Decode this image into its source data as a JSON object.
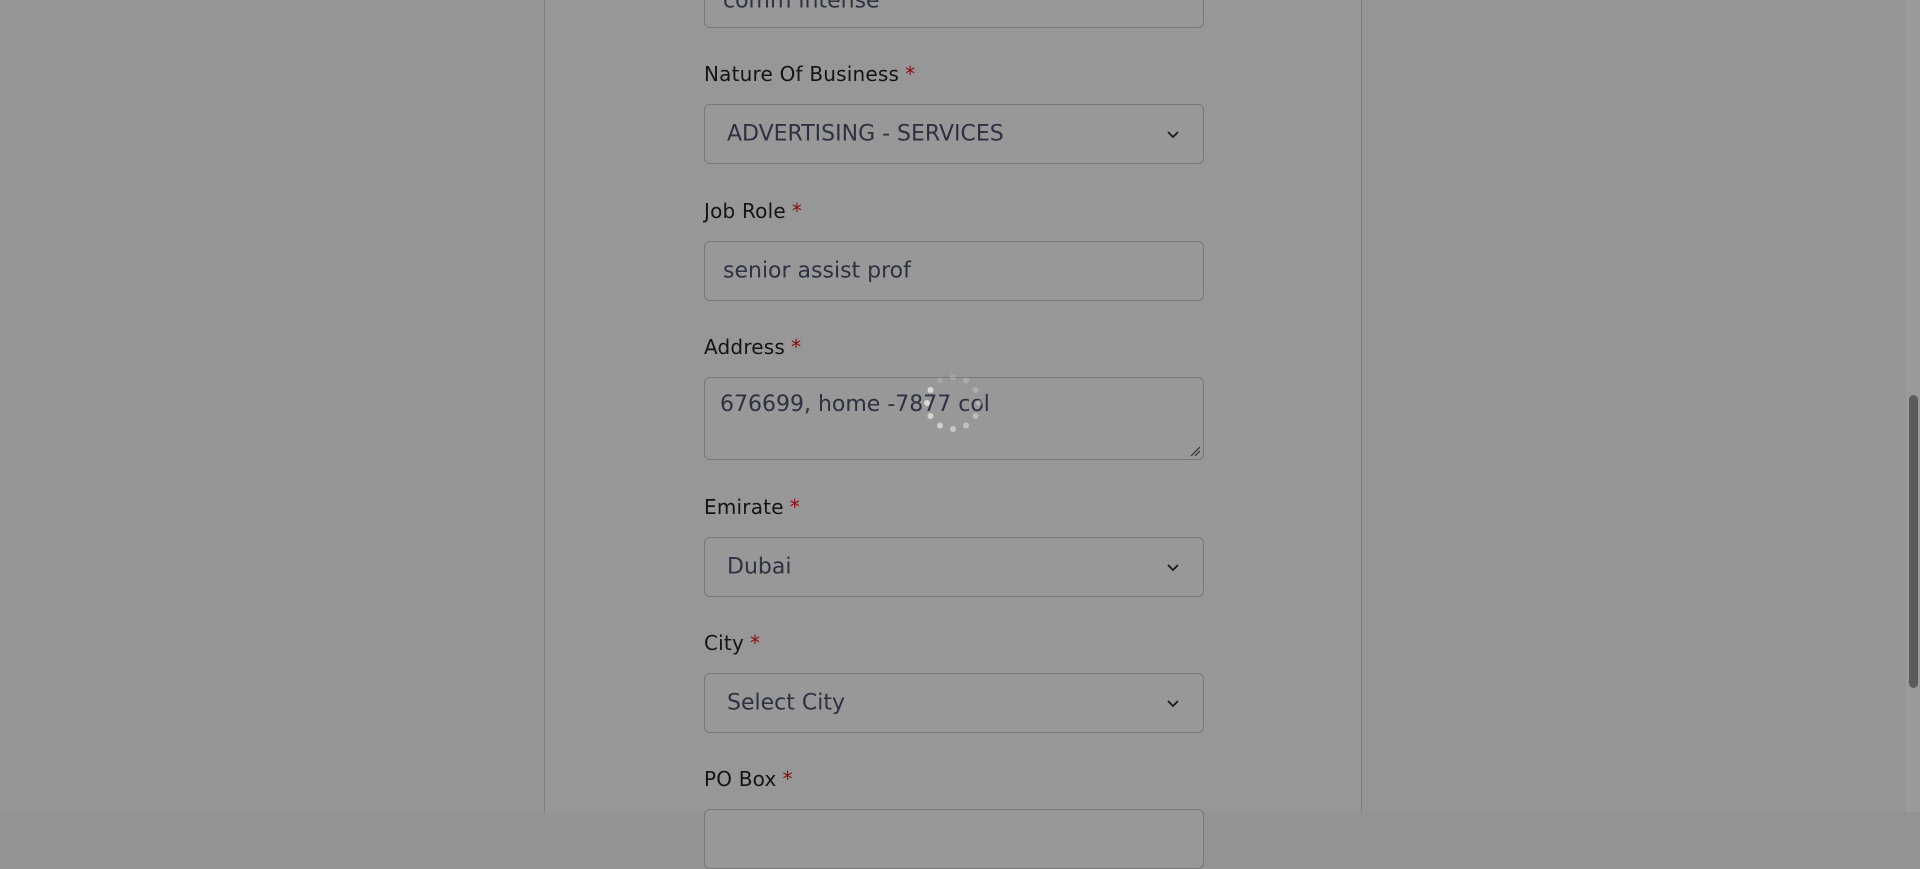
{
  "form": {
    "company_name": {
      "value": "comm intense"
    },
    "nature_of_business": {
      "label": "Nature Of Business",
      "required_mark": "*",
      "value": "ADVERTISING - SERVICES"
    },
    "job_role": {
      "label": "Job Role",
      "required_mark": "*",
      "value": "senior assist prof"
    },
    "address": {
      "label": "Address",
      "required_mark": "*",
      "value": "676699, home -7877 col"
    },
    "emirate": {
      "label": "Emirate",
      "required_mark": "*",
      "value": "Dubai"
    },
    "city": {
      "label": "City",
      "required_mark": "*",
      "value": "Select City"
    },
    "po_box": {
      "label": "PO Box",
      "required_mark": "*"
    }
  },
  "icons": {
    "dropdown": "chevron-down-icon",
    "loading": "loading-spinner-icon",
    "resize": "resize-grip-icon"
  },
  "colors": {
    "overlay_background": "#959595",
    "required_mark": "#8a0d0d",
    "input_text": "#2e3142"
  }
}
